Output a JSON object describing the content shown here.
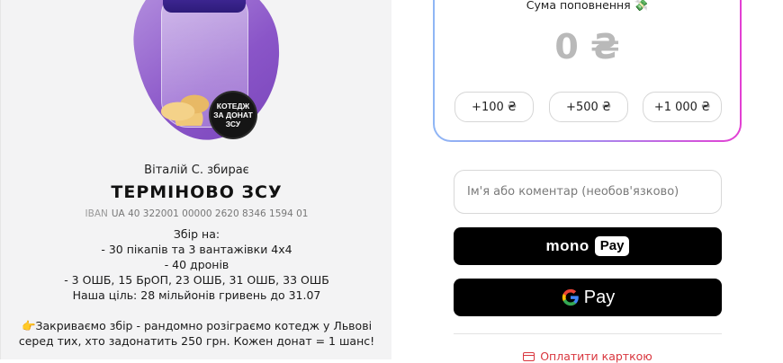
{
  "jar": {
    "avatar_text": "КОТЕДЖ ЗА ДОНАТ ЗСУ"
  },
  "collector": "Віталій С. збирає",
  "title": "ТЕРМІНОВО ЗСУ",
  "iban": {
    "label": "IBAN",
    "value": "UA 40 322001 00000 2620 8346 1594 01"
  },
  "description": {
    "lines": [
      "Збір на:",
      "- 30 пікапів та 3 вантажівки 4х4",
      "- 40 дронів",
      "- 3 ОШБ, 15 БрОП, 23 ОШБ, 31 ОШБ, 33 ОШБ",
      "Наша ціль: 28 мільйонів гривень до 31.07"
    ],
    "giveaway_lines": [
      "👉Закриваємо збір - рандомно розіграємо котедж у Львові",
      "серед тих, хто задонатить 250 грн. Кожен донат = 1 шанс!"
    ]
  },
  "amount": {
    "title": "Сума поповнення 💸",
    "value": "0 ₴",
    "quick": [
      "+100 ₴",
      "+500 ₴",
      "+1 000 ₴"
    ]
  },
  "comment": {
    "placeholder": "Ім'я або коментар (необов'язково)"
  },
  "payments": {
    "mono_word": "mono",
    "pay_word": "Pay",
    "gpay_word": "Pay",
    "card_link": "Оплатити карткою"
  },
  "colors": {
    "card_link": "#d9363e",
    "gradient_start": "#8fb6f5",
    "gradient_end": "#e33fd3",
    "jar_purple": "#8a55c8"
  }
}
